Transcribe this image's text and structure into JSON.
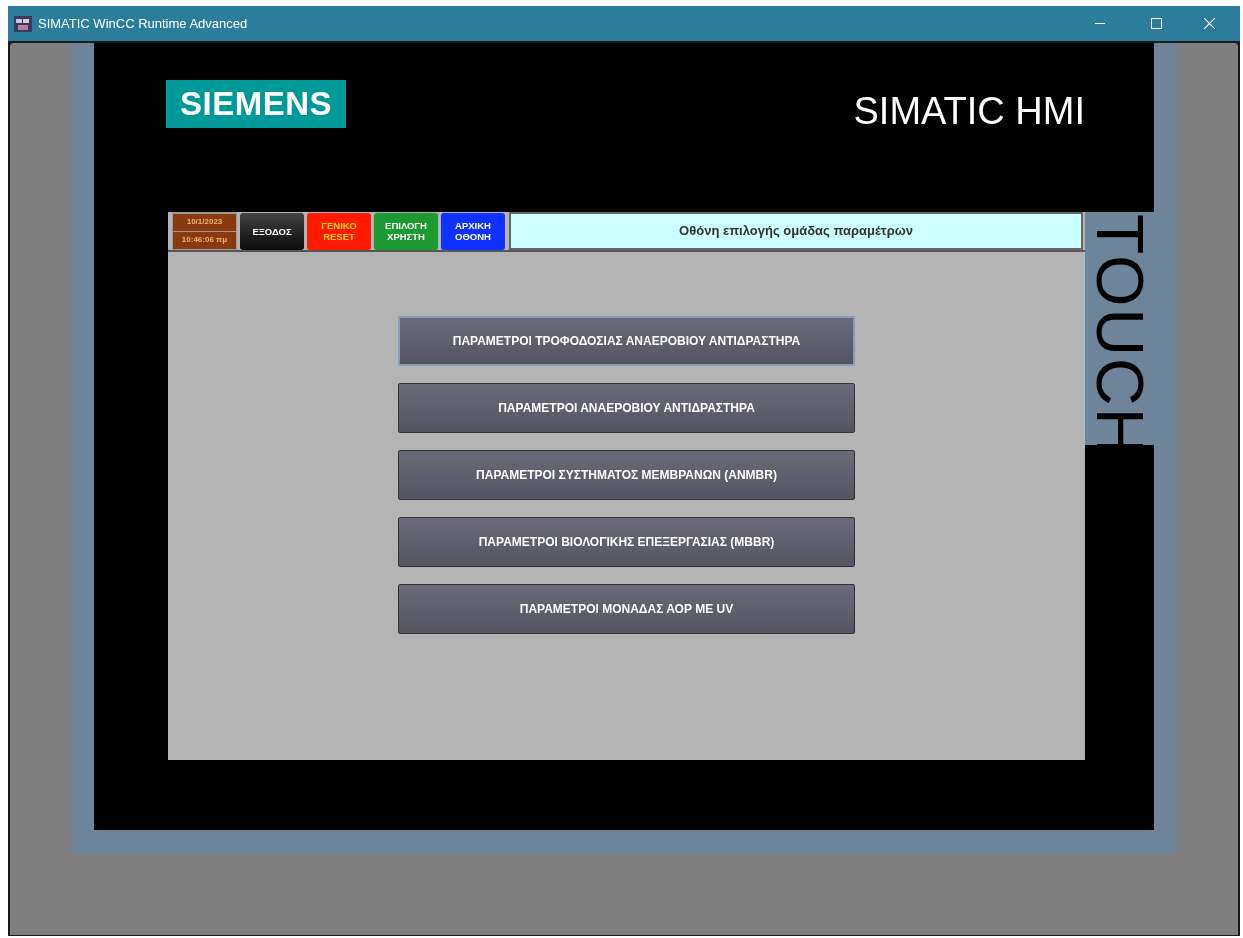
{
  "window": {
    "title": "SIMATIC WinCC Runtime Advanced"
  },
  "panel": {
    "brand": "SIEMENS",
    "product": "SIMATIC HMI",
    "side_label": "TOUCH"
  },
  "header": {
    "date": "10/1/2023",
    "time": "10:46:06 πμ",
    "buttons": [
      {
        "kind": "exit",
        "label": "ΕΞΟΔΟΣ"
      },
      {
        "kind": "reset",
        "label": "ΓΕΝΙΚΟ RESET"
      },
      {
        "kind": "user",
        "label": "ΕΠΙΛΟΓΗ ΧΡΗΣΤΗ"
      },
      {
        "kind": "home",
        "label": "ΑΡΧΙΚΗ ΟΘΟΝΗ"
      }
    ],
    "screen_title": "Οθόνη επιλογής ομάδας παραμέτρων"
  },
  "menu": [
    {
      "label": "ΠΑΡΑΜΕΤΡΟΙ ΤΡΟΦΟΔΟΣΙΑΣ ΑΝΑΕΡΟΒΙΟΥ ΑΝΤΙΔΡΑΣΤΗΡΑ",
      "focused": true
    },
    {
      "label": "ΠΑΡΑΜΕΤΡΟΙ ΑΝΑΕΡΟΒΙΟΥ ΑΝΤΙΔΡΑΣΤΗΡΑ",
      "focused": false
    },
    {
      "label": "ΠΑΡΑΜΕΤΡΟΙ ΣΥΣΤΗΜΑΤΟΣ ΜΕΜΒΡΑΝΩΝ (ANMBR)",
      "focused": false
    },
    {
      "label": "ΠΑΡΑΜΕΤΡΟΙ ΒΙΟΛΟΓΙΚΗΣ ΕΠΕΞΕΡΓΑΣΙΑΣ (MBBR)",
      "focused": false
    },
    {
      "label": "ΠΑΡΑΜΕΤΡΟΙ ΜΟΝΑΔΑΣ ΑΟΡ ΜΕ UV",
      "focused": false
    }
  ]
}
